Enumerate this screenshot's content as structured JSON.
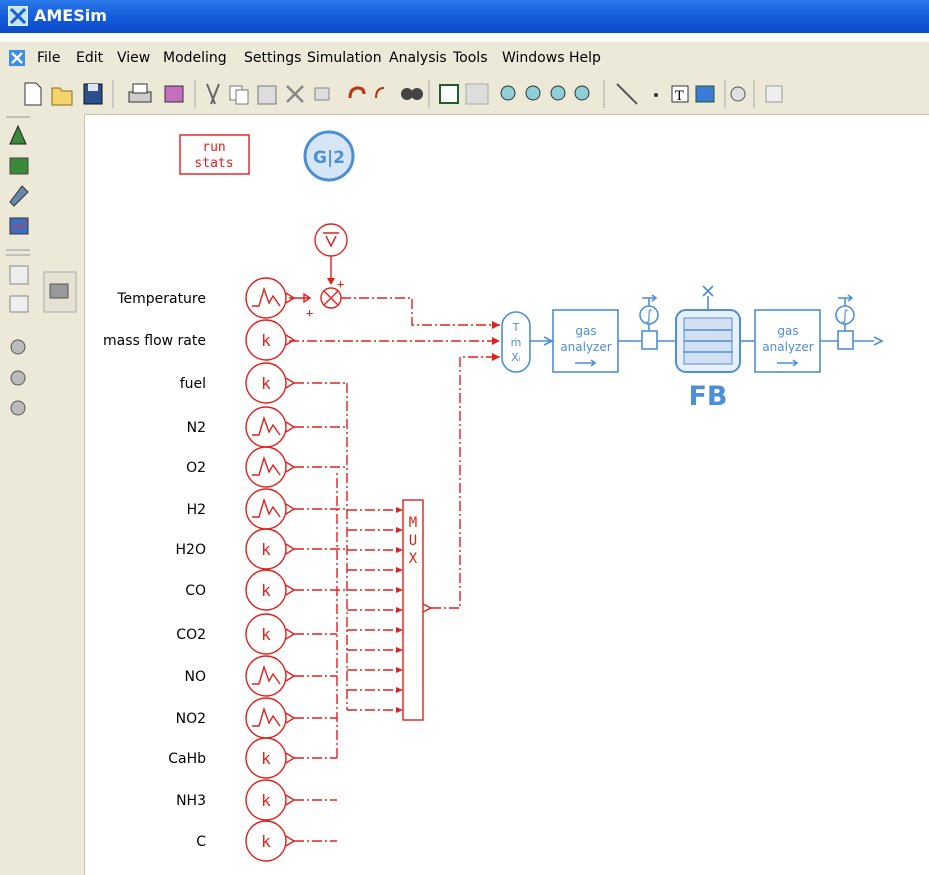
{
  "app": {
    "title": "AMESim"
  },
  "menu": [
    "File",
    "Edit",
    "View",
    "Modeling",
    "Settings",
    "Simulation",
    "Analysis",
    "Tools",
    "Windows",
    "Help"
  ],
  "canvas": {
    "run_stats": [
      "run",
      "stats"
    ],
    "g_badge": "G|2",
    "signals": [
      "Temperature",
      "mass flow rate",
      "fuel",
      "N2",
      "O2",
      "H2",
      "H2O",
      "CO",
      "CO2",
      "NO",
      "NO2",
      "CaHb",
      "NH3",
      "C"
    ],
    "constant_symbol": "k",
    "mux_label": [
      "M",
      "U",
      "X"
    ],
    "sensor_label": [
      "T",
      "ṁ",
      "Xᵢ"
    ],
    "gas_analyzer_1": [
      "gas",
      "analyzer"
    ],
    "gas_analyzer_2": [
      "gas",
      "analyzer"
    ],
    "fb_label": "FB",
    "integrator_symbol": "∫",
    "plus": "+"
  }
}
